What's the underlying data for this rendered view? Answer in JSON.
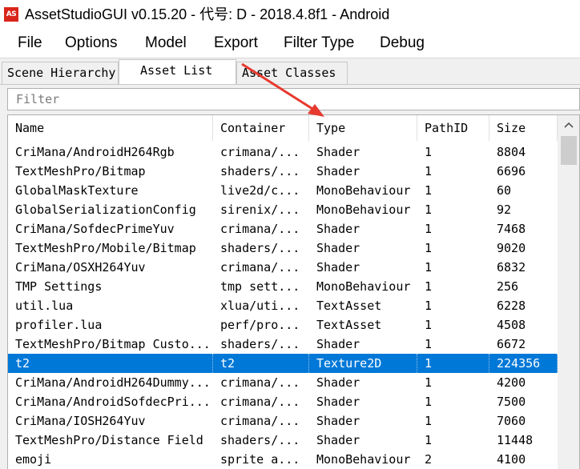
{
  "window": {
    "title": "AssetStudioGUI v0.15.20 - 代号: D - 2018.4.8f1 - Android",
    "icon_text": "AS"
  },
  "menu": [
    "File",
    "Options",
    "Model",
    "Export",
    "Filter Type",
    "Debug"
  ],
  "tabs": [
    {
      "label": "Scene Hierarchy",
      "active": false
    },
    {
      "label": "Asset List",
      "active": true
    },
    {
      "label": "Asset Classes",
      "active": false
    }
  ],
  "filter": {
    "placeholder": "Filter",
    "value": ""
  },
  "table": {
    "columns": [
      "Name",
      "Container",
      "Type",
      "PathID",
      "Size"
    ],
    "rows": [
      [
        "CriMana/AndroidH264Rgb",
        "crimana/...",
        "Shader",
        "1",
        "8804"
      ],
      [
        "TextMeshPro/Bitmap",
        "shaders/...",
        "Shader",
        "1",
        "6696"
      ],
      [
        "GlobalMaskTexture",
        "live2d/c...",
        "MonoBehaviour",
        "1",
        "60"
      ],
      [
        "GlobalSerializationConfig",
        "sirenix/...",
        "MonoBehaviour",
        "1",
        "92"
      ],
      [
        "CriMana/SofdecPrimeYuv",
        "crimana/...",
        "Shader",
        "1",
        "7468"
      ],
      [
        "TextMeshPro/Mobile/Bitmap",
        "shaders/...",
        "Shader",
        "1",
        "9020"
      ],
      [
        "CriMana/OSXH264Yuv",
        "crimana/...",
        "Shader",
        "1",
        "6832"
      ],
      [
        "TMP Settings",
        "tmp sett...",
        "MonoBehaviour",
        "1",
        "256"
      ],
      [
        "util.lua",
        "xlua/uti...",
        "TextAsset",
        "1",
        "6228"
      ],
      [
        "profiler.lua",
        "perf/pro...",
        "TextAsset",
        "1",
        "4508"
      ],
      [
        "TextMeshPro/Bitmap Custo...",
        "shaders/...",
        "Shader",
        "1",
        "6672"
      ],
      [
        "t2",
        "t2",
        "Texture2D",
        "1",
        "224356"
      ],
      [
        "CriMana/AndroidH264Dummy...",
        "crimana/...",
        "Shader",
        "1",
        "4200"
      ],
      [
        "CriMana/AndroidSofdecPri...",
        "crimana/...",
        "Shader",
        "1",
        "7500"
      ],
      [
        "CriMana/IOSH264Yuv",
        "crimana/...",
        "Shader",
        "1",
        "7060"
      ],
      [
        "TextMeshPro/Distance Field",
        "shaders/...",
        "Shader",
        "1",
        "11448"
      ],
      [
        "emoji",
        "sprite a...",
        "MonoBehaviour",
        "2",
        "4100"
      ]
    ],
    "selected_row": 11
  },
  "colors": {
    "selection": "#0078d7",
    "annotation_arrow": "#e8392f",
    "app_icon": "#d9261c"
  }
}
